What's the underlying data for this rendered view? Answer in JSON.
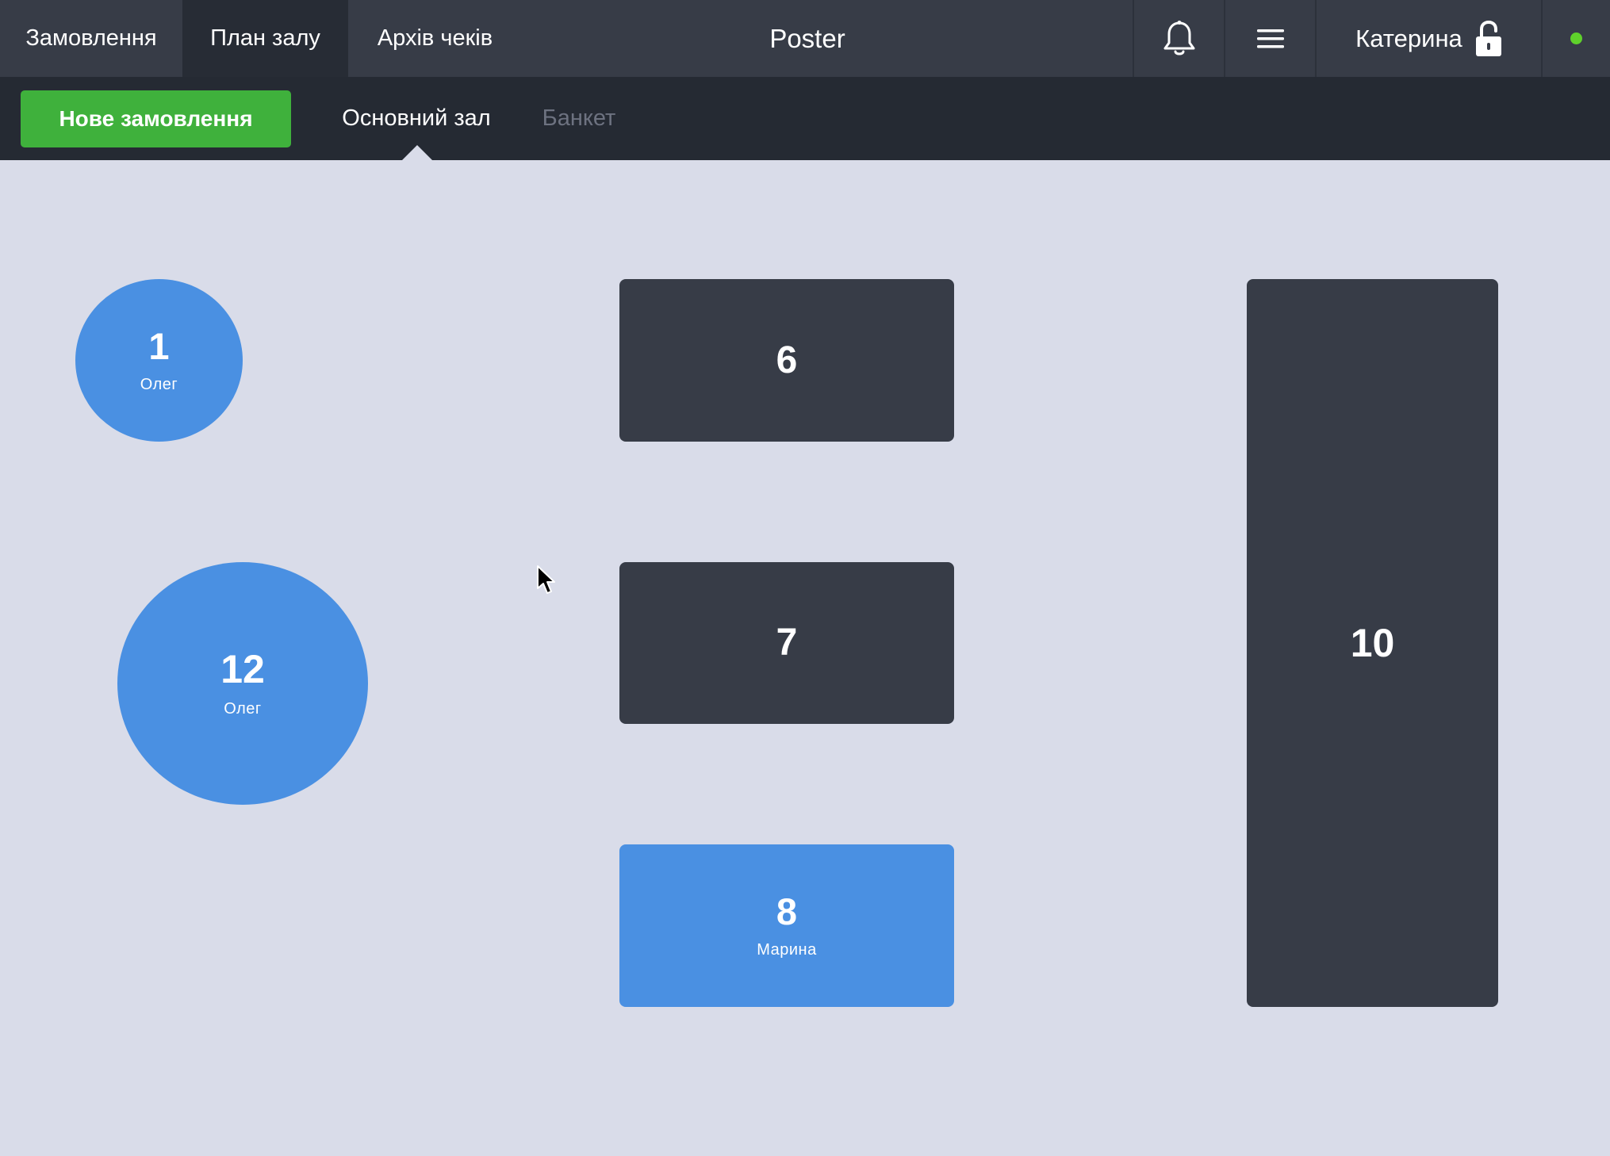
{
  "header": {
    "tabs": [
      {
        "label": "Замовлення"
      },
      {
        "label": "План залу",
        "active": true
      },
      {
        "label": "Архів чеків"
      }
    ],
    "app_title": "Poster",
    "icons": {
      "notifications": "bell-icon",
      "menu": "hamburger-menu-icon",
      "lock": "unlocked-padlock-icon",
      "status": "online-status-dot"
    },
    "user_name": "Катерина"
  },
  "subbar": {
    "new_order_label": "Нове замовлення",
    "halls": [
      {
        "label": "Основний зал",
        "active": true
      },
      {
        "label": "Банкет",
        "active": false
      }
    ]
  },
  "floor": {
    "tables": [
      {
        "number": "1",
        "shape": "round",
        "status": "busy",
        "waiter": "Олег"
      },
      {
        "number": "12",
        "shape": "round",
        "status": "busy",
        "waiter": "Олег"
      },
      {
        "number": "6",
        "shape": "rect",
        "status": "free",
        "waiter": ""
      },
      {
        "number": "7",
        "shape": "rect",
        "status": "free",
        "waiter": ""
      },
      {
        "number": "8",
        "shape": "rect",
        "status": "busy",
        "waiter": "Марина"
      },
      {
        "number": "10",
        "shape": "rect",
        "status": "free",
        "waiter": ""
      }
    ]
  },
  "colors": {
    "topbar_bg": "#373c47",
    "active_tab_bg": "#272c35",
    "subbar_bg": "#252a33",
    "floor_bg": "#d9dce9",
    "new_order_green": "#3fb13c",
    "busy_table_blue": "#4a90e2",
    "free_table_dark": "#373c47",
    "status_online": "#5fd12b",
    "inactive_hall_text": "#6d7280"
  }
}
